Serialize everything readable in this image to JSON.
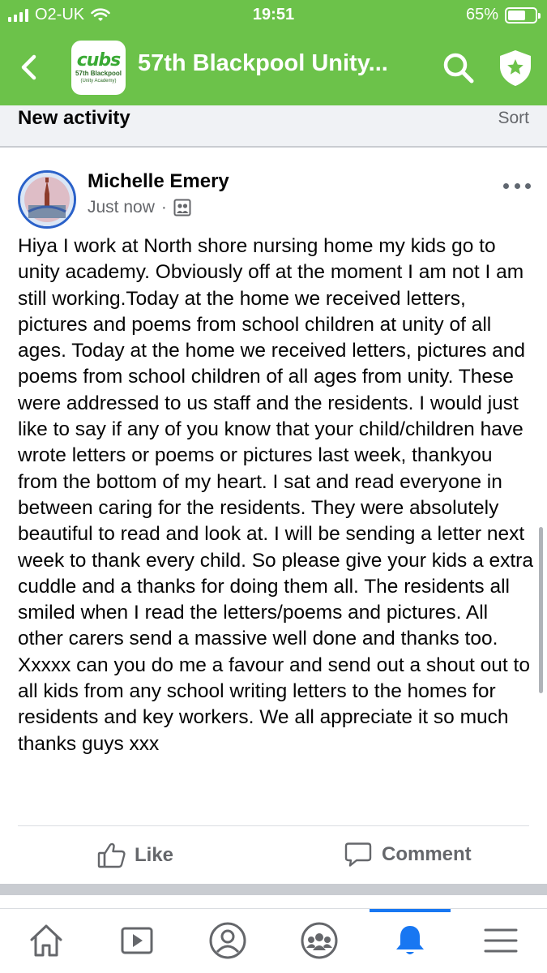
{
  "status_bar": {
    "carrier": "O2-UK",
    "time": "19:51",
    "battery": "65%",
    "battery_level": 0.65
  },
  "app_bar": {
    "group_name": "57th Blackpool Unity...",
    "logo": {
      "wordmark": "cubs",
      "line1": "57th Blackpool",
      "line2": "(Unity Academy)"
    },
    "icons": [
      "back-arrow-icon",
      "search-icon",
      "shield-star-icon"
    ]
  },
  "feed": {
    "section_title": "New activity",
    "sort_label": "Sort"
  },
  "post": {
    "author": "Michelle Emery",
    "timestamp": "Just now",
    "separator": "·",
    "audience_icon": "group-members-icon",
    "text": "Hiya I work at North shore nursing home my kids go to unity academy. Obviously off at the moment I am not I am still working.Today at the home we received letters, pictures and poems from school children at unity of all ages. Today at the home we received letters, pictures and poems from school children of all ages from unity. These were addressed to us staff and the residents. I would just like to say if any of you know that your child/children have wrote letters or poems or pictures last week, thankyou from the bottom of my heart. I sat and read everyone in between caring for the residents. They were absolutely beautiful to read and look at. I will be sending a letter next week to thank every child. So please give your kids a extra cuddle and a thanks for doing them all. The residents all smiled when I read the letters/poems and pictures. All other carers send a massive well done and thanks too. Xxxxx can you do me a favour and send out a shout out to all kids from any school writing letters to the homes for residents and key workers. We all appreciate it so much thanks guys xxx",
    "actions": {
      "like": "Like",
      "comment": "Comment"
    }
  },
  "tab_bar": {
    "tabs": [
      {
        "icon": "home-icon",
        "active": false
      },
      {
        "icon": "video-icon",
        "active": false
      },
      {
        "icon": "profile-icon",
        "active": false
      },
      {
        "icon": "groups-icon",
        "active": false
      },
      {
        "icon": "notifications-bell-icon",
        "active": true
      },
      {
        "icon": "menu-icon",
        "active": false
      }
    ]
  },
  "colors": {
    "header_green": "#6cc24a",
    "active_blue": "#1877f2",
    "secondary_text": "#65676b",
    "divider_gray": "#c9ccd1"
  }
}
